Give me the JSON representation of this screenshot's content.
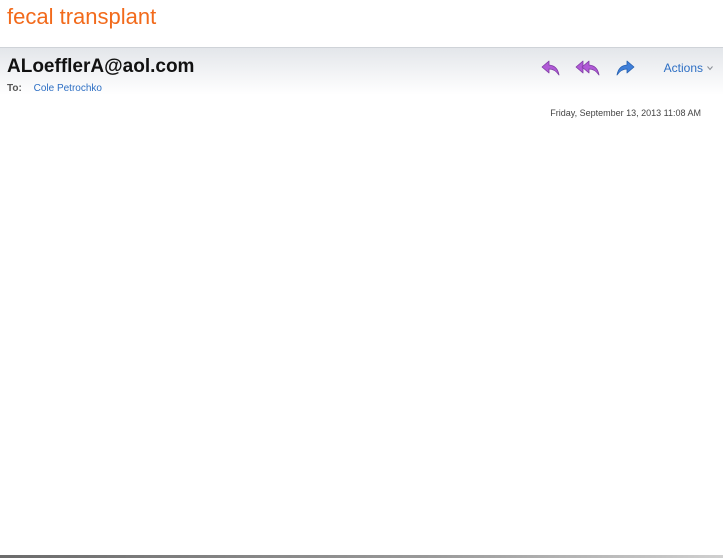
{
  "message": {
    "subject": "fecal transplant",
    "sender": "ALoefflerA@aol.com",
    "to_label": "To:",
    "to_recipient": "Cole Petrochko",
    "datetime": "Friday, September 13, 2013 11:08 AM",
    "body": ""
  },
  "toolbar": {
    "reply_icon": "reply-icon",
    "reply_all_icon": "reply-all-icon",
    "forward_icon": "forward-icon",
    "actions_label": "Actions",
    "actions_chevron": "chevron-down-icon"
  },
  "colors": {
    "subject": "#f26a1b",
    "link": "#2d6fc4",
    "reply_icon": "#b05ad6",
    "forward_icon": "#3f7fd9"
  }
}
